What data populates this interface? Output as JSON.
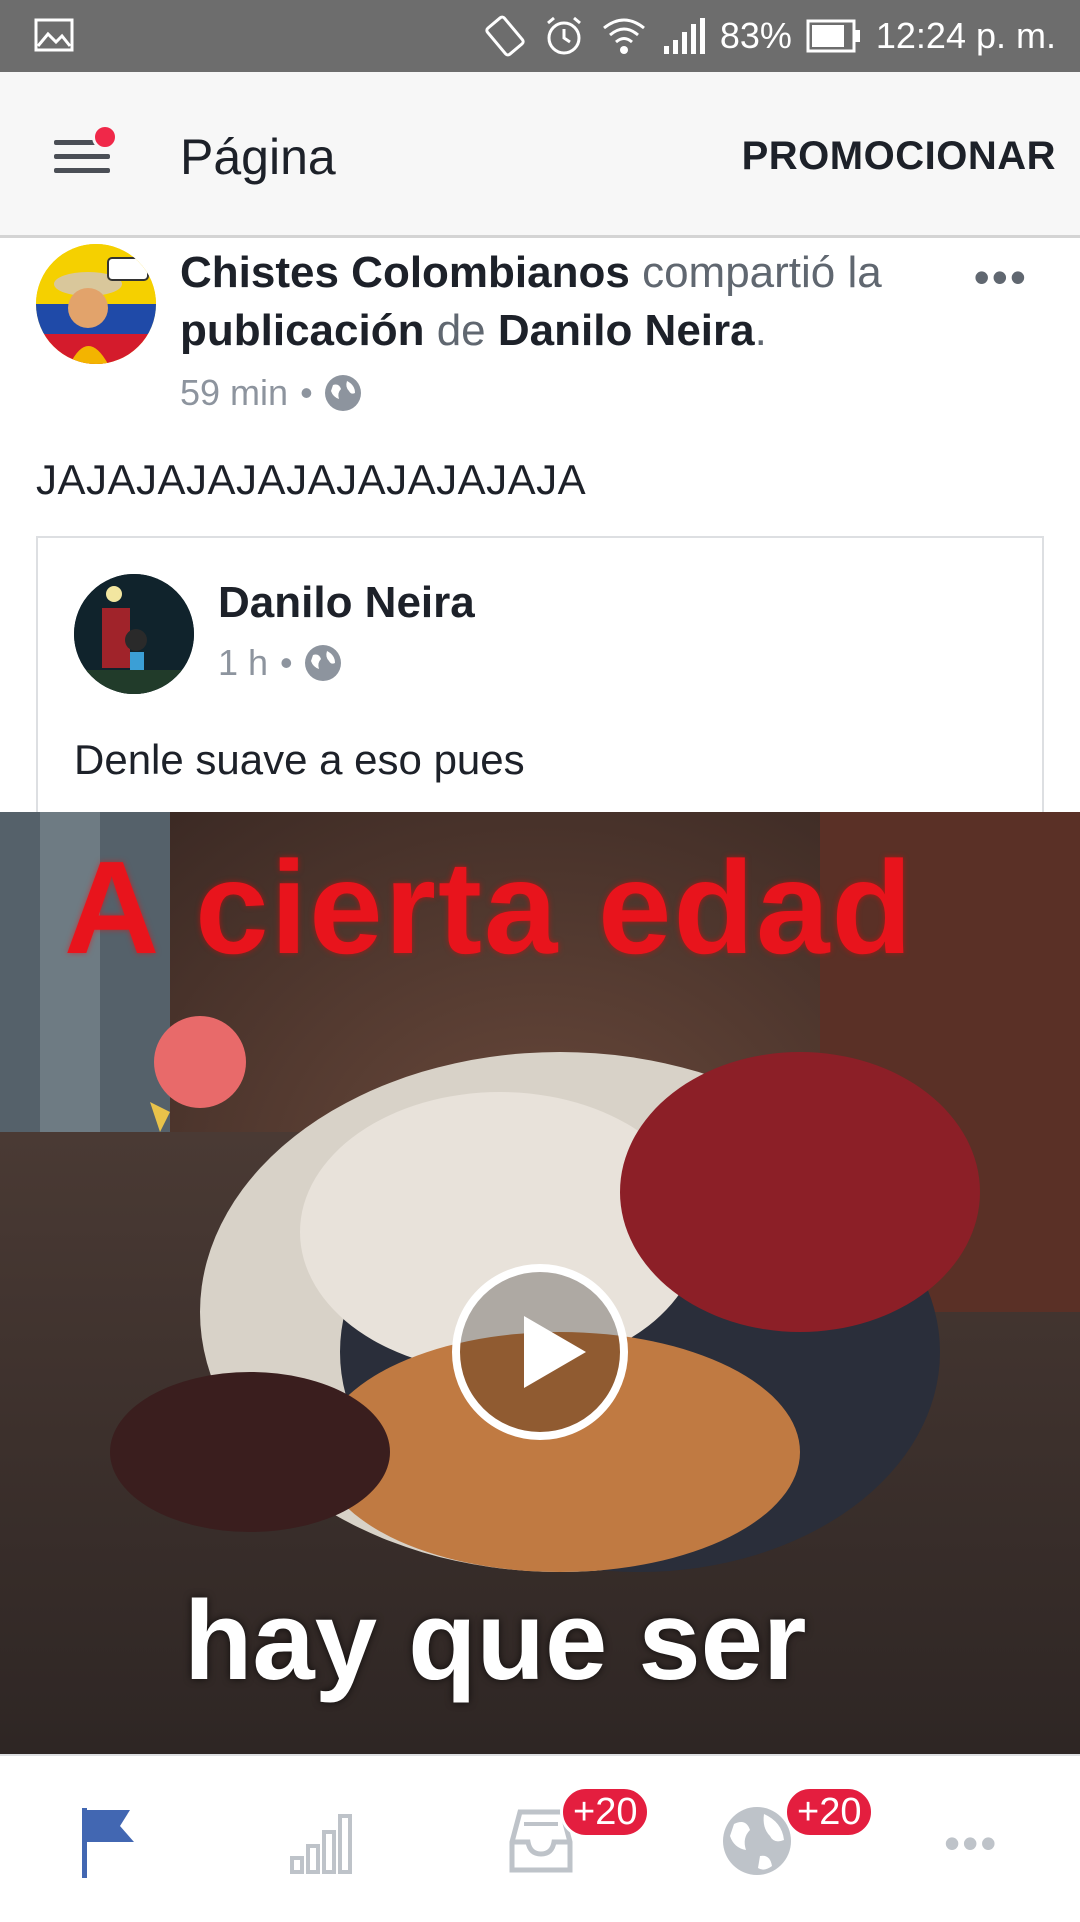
{
  "status_bar": {
    "battery": "83%",
    "time": "12:24 p. m.",
    "icons": [
      "gallery-icon",
      "rotate-icon",
      "alarm-icon",
      "wifi-icon",
      "signal-icon",
      "battery-icon"
    ]
  },
  "top_bar": {
    "title": "Página",
    "promote_label": "PROMOCIONAR"
  },
  "post": {
    "page_name": "Chistes Colombianos",
    "action_text": " compartió la ",
    "object_text": "publicación",
    "connector_text": " de ",
    "original_author": "Danilo Neira",
    "period": ".",
    "time": "59 min",
    "separator": "•",
    "more_label": "•••",
    "text": "JAJAJAJAJAJAJAJAJAJAJA"
  },
  "shared_post": {
    "author": "Danilo Neira",
    "time": "1 h",
    "separator": "•",
    "text": "Denle suave a eso pues"
  },
  "video": {
    "caption_top": "A cierta edad",
    "caption_bottom": "hay que ser"
  },
  "bottom_nav": {
    "items": [
      {
        "icon": "flag-icon",
        "active": true
      },
      {
        "icon": "insights-icon",
        "active": false
      },
      {
        "icon": "inbox-icon",
        "badge": "+20"
      },
      {
        "icon": "globe-icon",
        "badge": "+20"
      },
      {
        "icon": "more-icon",
        "label": "•••"
      }
    ]
  },
  "colors": {
    "status_bar": "#6d6d6d",
    "accent": "#4267b2",
    "badge": "#e41e3f",
    "caption_red": "#e8141c"
  }
}
